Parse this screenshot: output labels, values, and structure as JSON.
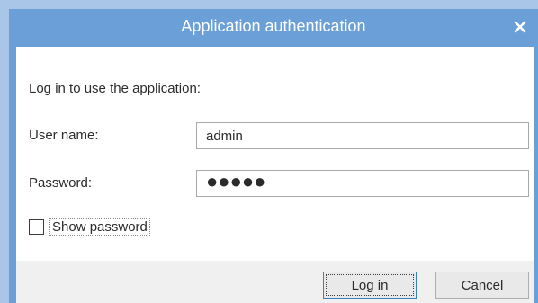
{
  "window": {
    "title": "Application authentication"
  },
  "form": {
    "intro": "Log in to use the application:",
    "username_label": "User name:",
    "username_value": "admin",
    "password_label": "Password:",
    "password_value": "●●●●●",
    "show_password_label": "Show password",
    "show_password_checked": false
  },
  "footer": {
    "login_label": "Log in",
    "cancel_label": "Cancel"
  },
  "icons": {
    "close": "close-icon"
  },
  "colors": {
    "titlebar": "#6a9fd8",
    "background": "#ffffff",
    "footer": "#f0f0f0"
  }
}
